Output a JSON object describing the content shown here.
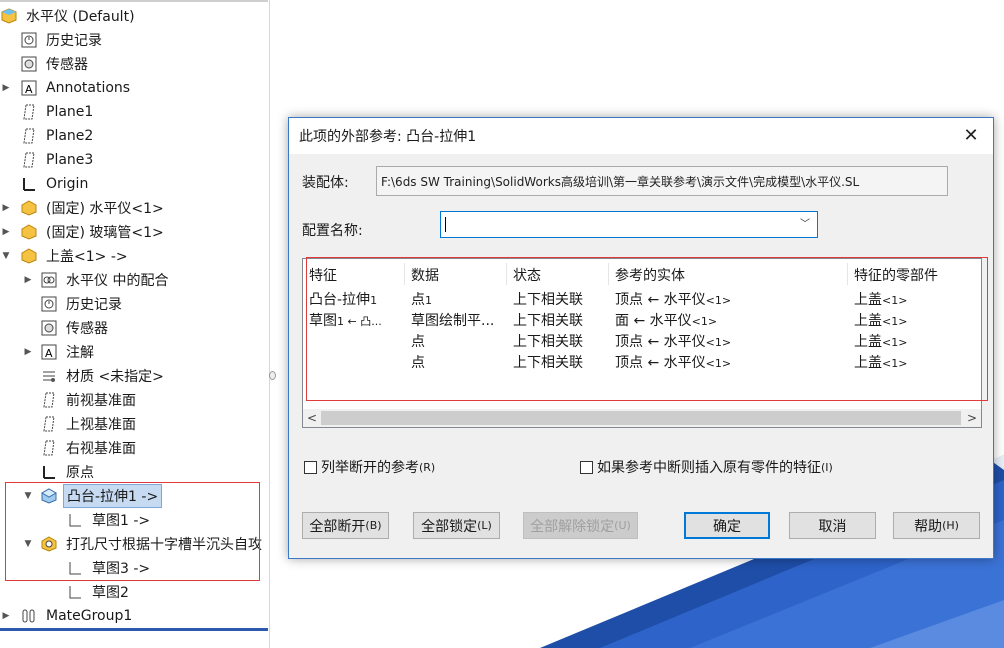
{
  "tree": {
    "root": "水平仪  (Default)",
    "items": [
      {
        "label": "历史记录",
        "icon": "history-icon"
      },
      {
        "label": "传感器",
        "icon": "sensor-icon"
      },
      {
        "label": "Annotations",
        "icon": "annotations-icon"
      },
      {
        "label": "Plane1",
        "icon": "plane-icon"
      },
      {
        "label": "Plane2",
        "icon": "plane-icon"
      },
      {
        "label": "Plane3",
        "icon": "plane-icon"
      },
      {
        "label": "Origin",
        "icon": "origin-icon"
      },
      {
        "label": "(固定) 水平仪<1>",
        "icon": "part-icon"
      },
      {
        "label": "(固定) 玻璃管<1>",
        "icon": "part-icon"
      },
      {
        "label": "上盖<1> ->",
        "icon": "part-icon"
      },
      {
        "label": "水平仪 中的配合",
        "icon": "mates-icon"
      },
      {
        "label": "历史记录",
        "icon": "history-icon"
      },
      {
        "label": "传感器",
        "icon": "sensor-icon"
      },
      {
        "label": "注解",
        "icon": "annotations-icon"
      },
      {
        "label": "材质 <未指定>",
        "icon": "material-icon"
      },
      {
        "label": "前视基准面",
        "icon": "plane-icon"
      },
      {
        "label": "上视基准面",
        "icon": "plane-icon"
      },
      {
        "label": "右视基准面",
        "icon": "plane-icon"
      },
      {
        "label": "原点",
        "icon": "origin-icon"
      },
      {
        "label": "凸台-拉伸1 ->",
        "icon": "extrude-icon"
      },
      {
        "label": "草图1 ->",
        "icon": "sketch-icon"
      },
      {
        "label": "打孔尺寸根据十字槽半沉头自攻",
        "icon": "hole-wizard-icon"
      },
      {
        "label": "草图3 ->",
        "icon": "sketch-icon"
      },
      {
        "label": "草图2",
        "icon": "sketch-icon"
      },
      {
        "label": "MateGroup1",
        "icon": "mategroup-icon"
      }
    ]
  },
  "dialog": {
    "title": "此项的外部参考: 凸台-拉伸1",
    "assembly_label": "装配体:",
    "assembly_path": "F:\\6ds SW Training\\SolidWorks高级培训\\第一章关联参考\\演示文件\\完成模型\\水平仪.SL",
    "config_label": "配置名称:",
    "config_value": "",
    "columns": [
      "特征",
      "数据",
      "状态",
      "参考的实体",
      "特征的零部件"
    ],
    "rows": [
      {
        "feature": "凸台-拉伸",
        "feature_sub": "1",
        "data": "点",
        "data_sub": "1",
        "status": "上下相关联",
        "entity": "顶点 ← 水平仪",
        "entity_sub": "<1>",
        "component": "上盖",
        "component_sub": "<1>"
      },
      {
        "feature": "草图",
        "feature_sub": "1 ← 凸...",
        "data": "草图绘制平...",
        "data_sub": "",
        "status": "上下相关联",
        "entity": "面 ← 水平仪",
        "entity_sub": "<1>",
        "component": "上盖",
        "component_sub": "<1>"
      },
      {
        "feature": "",
        "feature_sub": "",
        "data": "点",
        "data_sub": "",
        "status": "上下相关联",
        "entity": "顶点 ← 水平仪",
        "entity_sub": "<1>",
        "component": "上盖",
        "component_sub": "<1>"
      },
      {
        "feature": "",
        "feature_sub": "",
        "data": "点",
        "data_sub": "",
        "status": "上下相关联",
        "entity": "顶点 ← 水平仪",
        "entity_sub": "<1>",
        "component": "上盖",
        "component_sub": "<1>"
      }
    ],
    "checkbox_list_broken": "列举断开的参考",
    "checkbox_list_broken_key": "(R)",
    "checkbox_insert": "如果参考中断则插入原有零件的特征",
    "checkbox_insert_key": "(I)",
    "buttons": {
      "break_all": "全部断开",
      "break_all_key": "(B)",
      "lock_all": "全部锁定",
      "lock_all_key": "(L)",
      "unlock_all": "全部解除锁定",
      "unlock_all_key": "(U)",
      "ok": "确定",
      "cancel": "取消",
      "help": "帮助",
      "help_key": "(H)"
    }
  },
  "colors": {
    "accent": "#0078d7",
    "highlight_box": "#e23a3a",
    "selection": "#c6dbf2",
    "bg_blue": "#2c58b0"
  }
}
